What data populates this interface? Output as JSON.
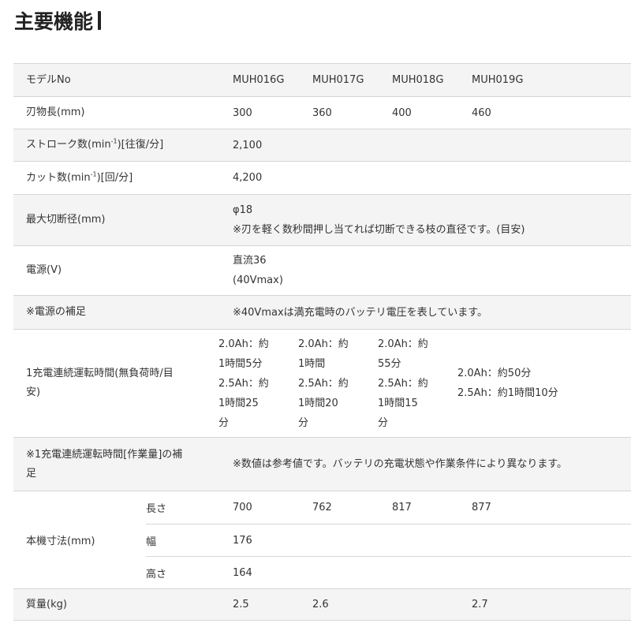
{
  "title": "主要機能",
  "header": {
    "label": "モデルNo",
    "models": [
      "MUH016G",
      "MUH017G",
      "MUH018G",
      "MUH019G"
    ]
  },
  "rows": {
    "blade": {
      "label": "刃物長(mm)",
      "values": [
        "300",
        "360",
        "400",
        "460"
      ]
    },
    "stroke": {
      "label_pre": "ストローク数(min",
      "label_sup": "-1",
      "label_post": ")[往復/分]",
      "value": "2,100"
    },
    "cut": {
      "label_pre": "カット数(min",
      "label_sup": "-1",
      "label_post": ")[回/分]",
      "value": "4,200"
    },
    "max_cut": {
      "label": "最大切断径(mm)",
      "line1": "φ18",
      "line2": "※刃を軽く数秒間押し当てれば切断できる枝の直径です。(目安)"
    },
    "power": {
      "label": "電源(V)",
      "line1": "直流36",
      "line2": "(40Vmax)"
    },
    "power_note": {
      "label": "※電源の補足",
      "value": "※40Vmaxは満充電時のバッテリ電圧を表しています。"
    },
    "runtime": {
      "label_line1": "1充電連続運転時間(無負荷時/目",
      "label_line2": "安)",
      "cols": [
        [
          "2.0Ah：約",
          "1時間5分",
          "2.5Ah：約",
          "1時間25",
          "分"
        ],
        [
          "2.0Ah：約",
          "1時間",
          "2.5Ah：約",
          "1時間20",
          "分"
        ],
        [
          "2.0Ah：約",
          "55分",
          "2.5Ah：約",
          "1時間15",
          "分"
        ],
        [
          "2.0Ah：約50分",
          "2.5Ah：約1時間10分"
        ]
      ]
    },
    "runtime_note": {
      "label_line1": "※1充電連続運転時間[作業量]の補",
      "label_line2": "足",
      "value": "※数値は参考値です。バッテリの充電状態や作業条件により異なります。"
    },
    "dimensions": {
      "label": "本機寸法(mm)",
      "length": {
        "label": "長さ",
        "values": [
          "700",
          "762",
          "817",
          "877"
        ]
      },
      "width": {
        "label": "幅",
        "value": "176"
      },
      "height": {
        "label": "高さ",
        "value": "164"
      }
    },
    "mass": {
      "label": "質量(kg)",
      "values": [
        "2.5",
        "2.6",
        "",
        "2.7"
      ]
    }
  }
}
